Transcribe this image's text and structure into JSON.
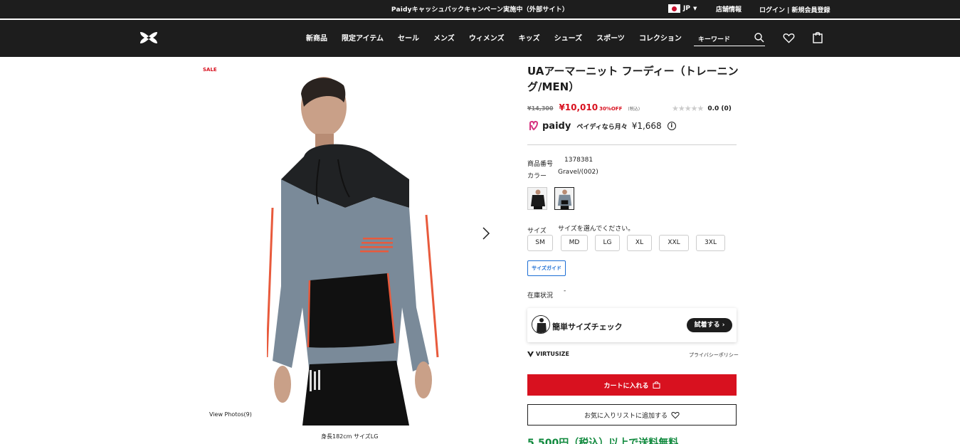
{
  "topbar": {
    "promo": "Paidyキャッシュバックキャンペーン実施中（外部サイト）",
    "language": "JP",
    "store_info": "店舗情報",
    "login": "ログイン | 新規会員登録"
  },
  "nav": {
    "items": [
      "新商品",
      "限定アイテム",
      "セール",
      "メンズ",
      "ウィメンズ",
      "キッズ",
      "シューズ",
      "スポーツ",
      "コレクション"
    ],
    "search_placeholder": "キーワード"
  },
  "gallery": {
    "sale_badge": "SALE",
    "view_photos": "View Photos(9)",
    "caption": "身長182cm サイズLG"
  },
  "product": {
    "title": "UAアーマーニット フーディー（トレーニング/MEN）",
    "old_price": "¥14,300",
    "price": "¥10,010",
    "discount": "30%OFF",
    "tax": "(税込)",
    "rating_text": "0.0 (0)",
    "rating_value": 0,
    "paidy_word": "paidy",
    "paidy_text": "ペイディなら月々",
    "paidy_amount": "¥1,668",
    "info_icon": "i",
    "code_label": "商品番号",
    "code_value": "1378381",
    "color_label": "カラー",
    "color_value": "Gravel/(002)",
    "size_label": "サイズ",
    "size_hint": "サイズを選んでください。",
    "sizes": [
      "SM",
      "MD",
      "LG",
      "XL",
      "XXL",
      "3XL"
    ],
    "size_guide": "サイズガイド",
    "stock_label": "在庫状況",
    "stock_value": "-"
  },
  "virtusize": {
    "check_text": "簡単サイズチェック",
    "try_button": "試着する",
    "logo_text": "VIRTUSIZE",
    "privacy": "プライバシーポリシー"
  },
  "actions": {
    "add_to_cart": "カートに入れる",
    "add_to_wishlist": "お気に入りリストに追加する",
    "shipping_note": "5,500円（税込）以上で送料無料"
  },
  "colors": {
    "brand_red": "#d8111f",
    "dark": "#1d1d1d",
    "link_blue": "#1c6ed4",
    "green": "#128a3f"
  }
}
